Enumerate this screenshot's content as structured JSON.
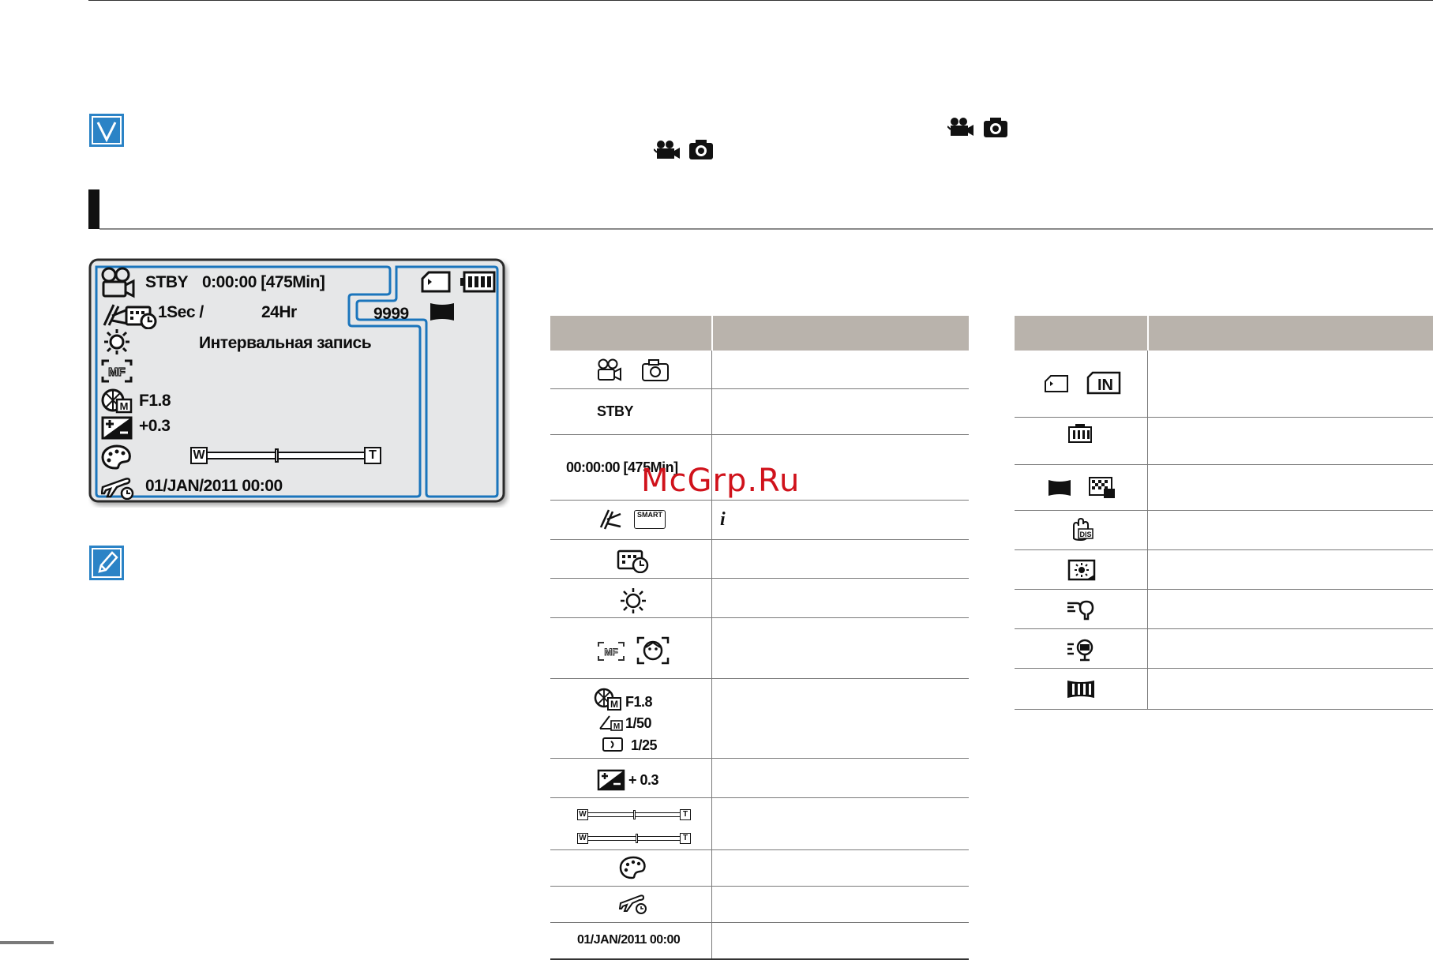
{
  "icons": {
    "note_check": "check-note-icon",
    "note_pencil": "pencil-note-icon",
    "movie": "movie-camera-icon",
    "photo": "photo-camera-icon"
  },
  "lcd": {
    "mode": "STBY",
    "time": "0:00:00 [475Min]",
    "interval_value": "1Sec /",
    "interval_total": "24Hr",
    "interval_caption": "Интервальная запись",
    "count": "9999",
    "aperture": "F1.8",
    "exposure": "+0.3",
    "zoom_w": "W",
    "zoom_t": "T",
    "zoom_level": 0.44,
    "datetime": "01/JAN/2011 00:00"
  },
  "left_table": {
    "rows": [
      {
        "icon": "movie-photo-mode-icons"
      },
      {
        "text": "STBY"
      },
      {
        "text": "00:00:00 [475Min]"
      },
      {
        "icon": "smart-auto-icons",
        "badge": "SMART",
        "desc": "i"
      },
      {
        "icon": "time-lapse-icon"
      },
      {
        "icon": "white-balance-icon"
      },
      {
        "icon": "focus-icons",
        "badge": "MF"
      },
      {
        "lines": [
          "F1.8",
          "1/50",
          "1/25"
        ]
      },
      {
        "text": "+ 0.3"
      },
      {
        "icon": "zoom-bars",
        "w": "W",
        "t": "T",
        "level1": 0.5,
        "level2": 0.53
      },
      {
        "icon": "digital-effect-icon"
      },
      {
        "icon": "time-zone-icon"
      },
      {
        "text": "01/JAN/2011 00:00"
      }
    ]
  },
  "right_table": {
    "storage_label": "IN",
    "rows": [
      {
        "icon": "storage-icons"
      },
      {
        "icon": "battery-icon"
      },
      {
        "icon": "resolution-icons"
      },
      {
        "icon": "dis-icon"
      },
      {
        "icon": "backlight-icon"
      },
      {
        "icon": "wind-cut-icon"
      },
      {
        "icon": "anti-shake-icon"
      },
      {
        "icon": "wide-icon"
      }
    ]
  },
  "watermark": "McGrp.Ru",
  "colors": {
    "lcd_frame": "#1b75bc",
    "lcd_bg": "#e6e7e8",
    "table_header": "#b9b3ac",
    "note_icon": "#2b83c6",
    "watermark": "#d0121b"
  }
}
